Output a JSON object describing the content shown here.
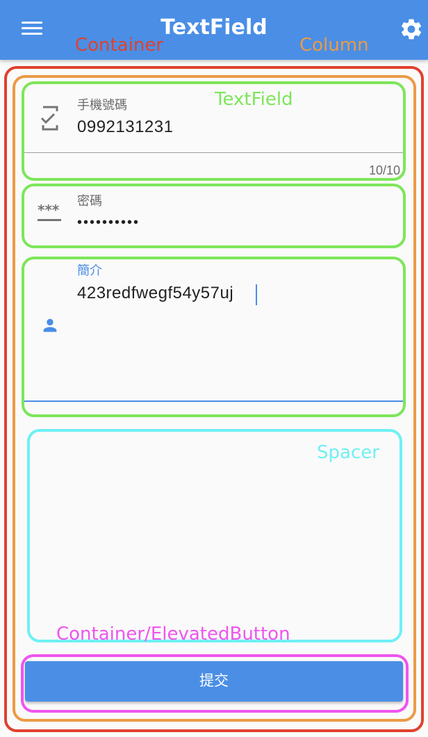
{
  "appbar": {
    "title": "TextField"
  },
  "icons": {
    "menu": "menu-icon",
    "settings": "gear-icon",
    "phone": "phone-check-icon",
    "password": "password-icon",
    "person": "person-icon"
  },
  "annotations": {
    "container": "Container",
    "column": "Column",
    "textfield": "TextField",
    "spacer": "Spacer",
    "button": "Container/ElevatedButton"
  },
  "annotation_colors": {
    "container": "#e0412e",
    "column": "#ec9a45",
    "textfield": "#7de65a",
    "spacer": "#6ef0f4",
    "button": "#ee55ee"
  },
  "fields": {
    "phone": {
      "label": "手機號碼",
      "value": "0992131231",
      "counter": "10/10"
    },
    "password": {
      "label": "密碼",
      "value": "••••••••••"
    },
    "bio": {
      "label": "簡介",
      "value": "423redfwegf54y57uj"
    }
  },
  "submit": {
    "label": "提交"
  },
  "colors": {
    "primary": "#4a8ee6",
    "background": "#fafafa"
  }
}
